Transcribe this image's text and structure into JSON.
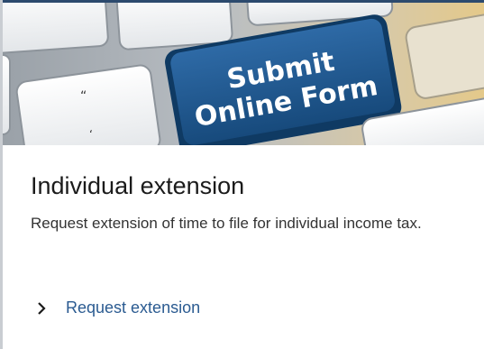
{
  "hero": {
    "image_caption_line1": "Submit",
    "image_caption_line2": "Online Form"
  },
  "card": {
    "title": "Individual extension",
    "description": "Request extension of time to file for individual income tax.",
    "link_label": "Request extension"
  },
  "icons": {
    "link_icon": "chevron-right-icon"
  },
  "colors": {
    "key_blue": "#1f5a94",
    "link": "#2b5b91",
    "title": "#1b1b1b"
  }
}
